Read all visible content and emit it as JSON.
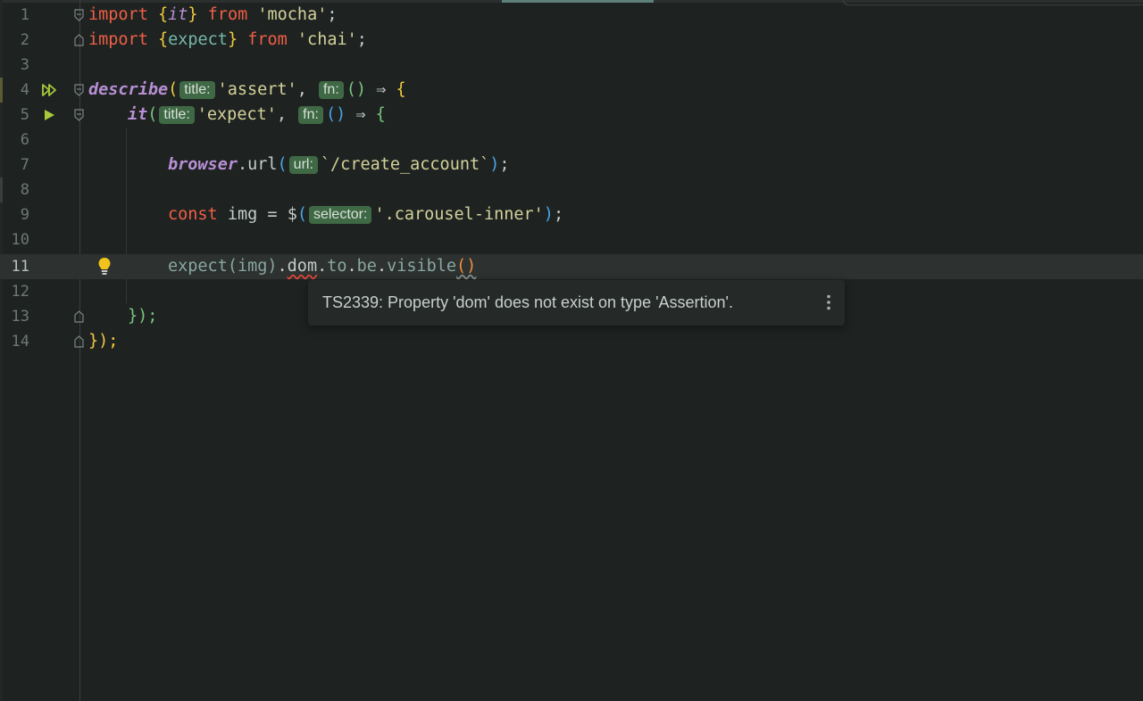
{
  "editor": {
    "line_numbers": [
      "1",
      "2",
      "3",
      "4",
      "5",
      "6",
      "7",
      "8",
      "9",
      "10",
      "11",
      "12",
      "13",
      "14"
    ],
    "tokens": {
      "l1_import": "import",
      "l1_open": "{",
      "l1_it": "it",
      "l1_close": "}",
      "l1_from": "from",
      "l1_str": "'mocha'",
      "l1_semi": ";",
      "l2_import": "import",
      "l2_open": "{",
      "l2_expect": "expect",
      "l2_close": "}",
      "l2_from": "from",
      "l2_str": "'chai'",
      "l2_semi": ";",
      "l4_describe": "describe",
      "l4_paren": "(",
      "l4_str": "'assert'",
      "l4_comma": ",",
      "l4_arrow_parens": "()",
      "l4_arrow": "⇒",
      "l4_brace": "{",
      "l5_it": "it",
      "l5_paren": "(",
      "l5_str": "'expect'",
      "l5_comma": ",",
      "l5_arrow_parens": "()",
      "l5_arrow": "⇒",
      "l5_brace": "{",
      "l7_browser": "browser",
      "l7_dot": ".",
      "l7_url": "url",
      "l7_paren": "(",
      "l7_str": "`/create_account`",
      "l7_close": ")",
      "l7_semi": ";",
      "l9_const": "const",
      "l9_name": "img",
      "l9_eq": "=",
      "l9_dollar": "$",
      "l9_paren": "(",
      "l9_str": "'.carousel-inner'",
      "l9_close": ")",
      "l9_semi": ";",
      "l11_expect": "expect",
      "l11_paren": "(",
      "l11_img": "img",
      "l11_close": ")",
      "l11_dot1": ".",
      "l11_dom": "dom",
      "l11_dot2": ".",
      "l11_to": "to",
      "l11_dot3": ".",
      "l11_be": "be",
      "l11_dot4": ".",
      "l11_visible": "visible",
      "l11_call": "()",
      "l13_close": "});",
      "l14_close": "});"
    },
    "inlay_hints": {
      "describe_title": "title:",
      "describe_fn": "fn:",
      "it_title": "title:",
      "it_fn": "fn:",
      "url": "url:",
      "selector": "selector:"
    },
    "current_line": "11"
  },
  "tooltip": {
    "message": "TS2339: Property 'dom' does not exist on type 'Assertion'."
  },
  "icons": {
    "run_all": "run-all-tests-icon",
    "run": "run-test-icon",
    "fold": "fold-icon",
    "bulb": "lightbulb-icon",
    "more": "more-vertical-icon"
  },
  "colors": {
    "background": "#1e2322",
    "keyword": "#ef5f45",
    "function": "#b88fd4",
    "string": "#d4d199",
    "hint_bg": "#3f6845",
    "error": "#e0453a"
  }
}
